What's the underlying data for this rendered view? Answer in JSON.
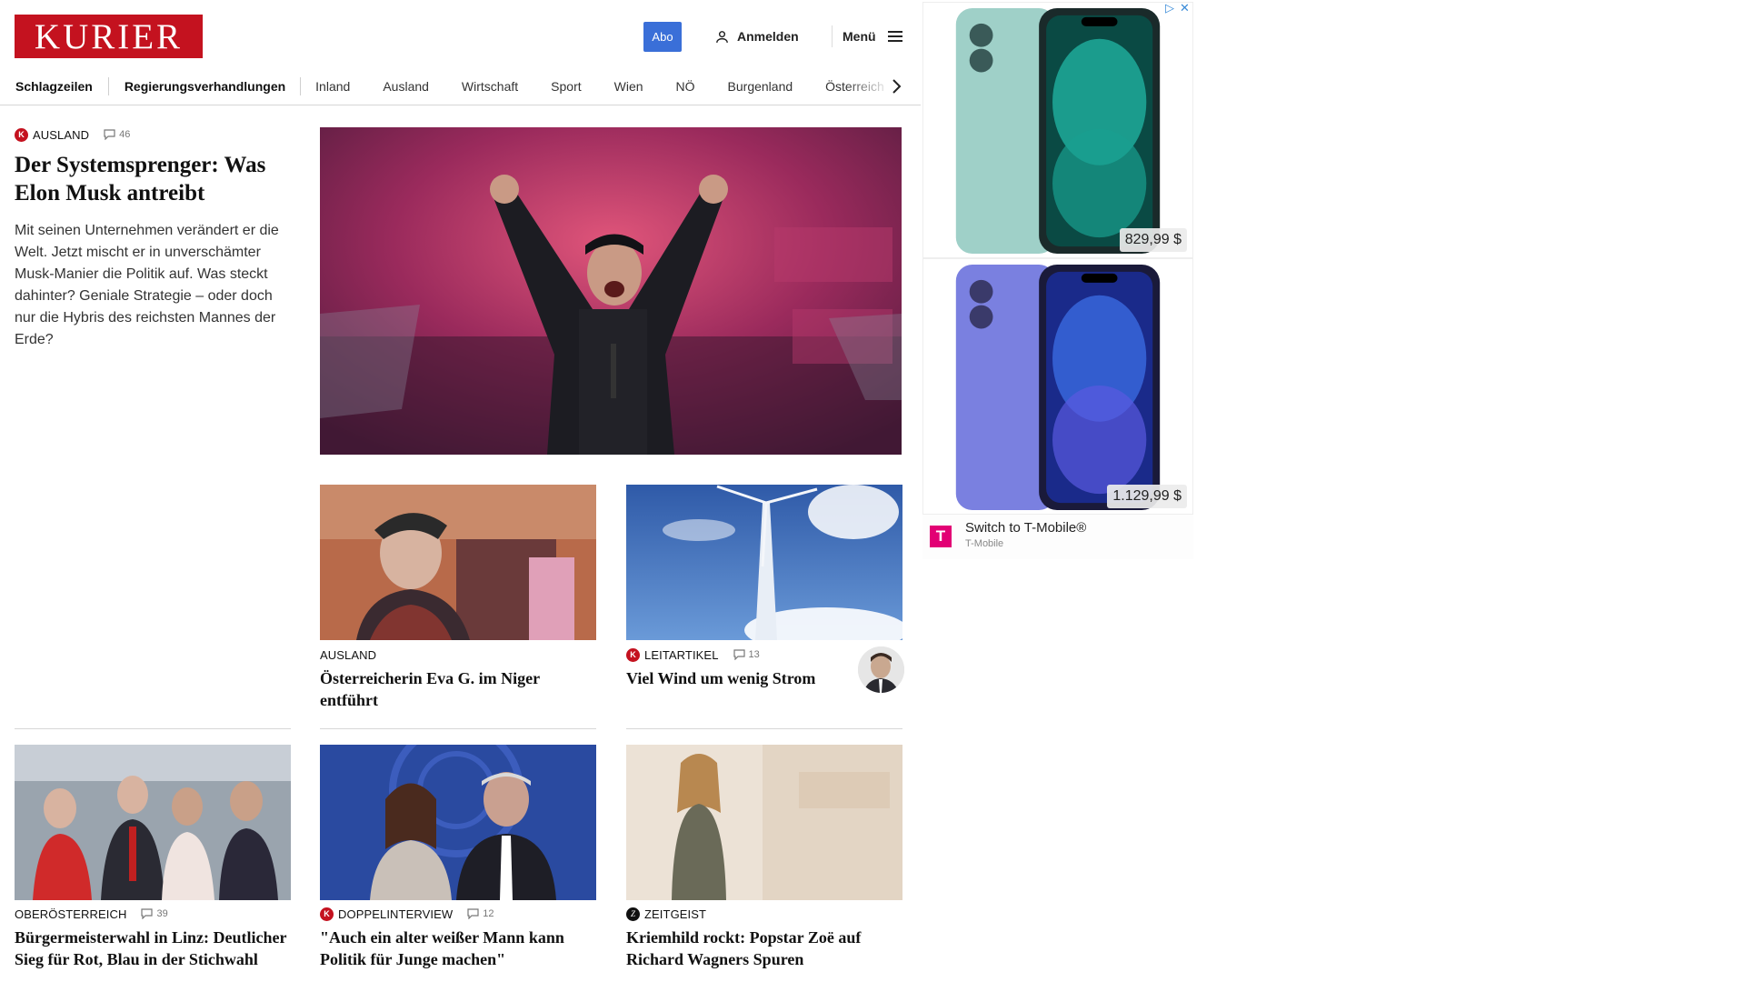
{
  "header": {
    "logo": "KURIER",
    "abo_label": "Abo",
    "login_label": "Anmelden",
    "menu_label": "Menü"
  },
  "nav": {
    "items": [
      "Schlagzeilen",
      "Regierungsverhandlungen",
      "Inland",
      "Ausland",
      "Wirtschaft",
      "Sport",
      "Wien",
      "NÖ",
      "Burgenland",
      "Österreich"
    ]
  },
  "lead": {
    "category": "AUSLAND",
    "comments": "46",
    "headline": "Der Systemsprenger: Was Elon Musk antreibt",
    "teaser": "Mit seinen Unternehmen verändert er die Welt. Jetzt mischt er in unverschämter Musk-Manier die Politik auf. Was steckt dahinter? Geniale Strategie – oder doch nur die Hybris des reichsten Mannes der Erde?"
  },
  "articles": [
    {
      "category": "AUSLAND",
      "comments": "",
      "headline": "Österreicherin Eva G. im Niger entführt",
      "badge": ""
    },
    {
      "category": "LEITARTIKEL",
      "comments": "13",
      "headline": "Viel Wind um wenig Strom",
      "badge": "K"
    },
    {
      "category": "OBERÖSTERREICH",
      "comments": "39",
      "headline": "Bürgermeisterwahl in Linz: Deutli­cher Sieg für Rot, Blau in der Stichwahl",
      "badge": ""
    },
    {
      "category": "DOPPELINTERVIEW",
      "comments": "12",
      "headline": "\"Auch ein alter weißer Mann kann Politik für Junge machen\"",
      "badge": "K"
    },
    {
      "category": "ZEITGEIST",
      "comments": "",
      "headline": "Kriemhild rockt: Popstar Zoë auf Richard Wagners Spuren",
      "badge": "Z"
    }
  ],
  "ad": {
    "price_1": "829,99 $",
    "price_2": "1.129,99 $",
    "title": "Switch to T-Mobile®",
    "brand": "T-Mobile",
    "logo_letter": "T"
  },
  "colors": {
    "brand_red": "#c4121f",
    "abo_blue": "#3a6fd8",
    "tmobile_magenta": "#e20074"
  }
}
